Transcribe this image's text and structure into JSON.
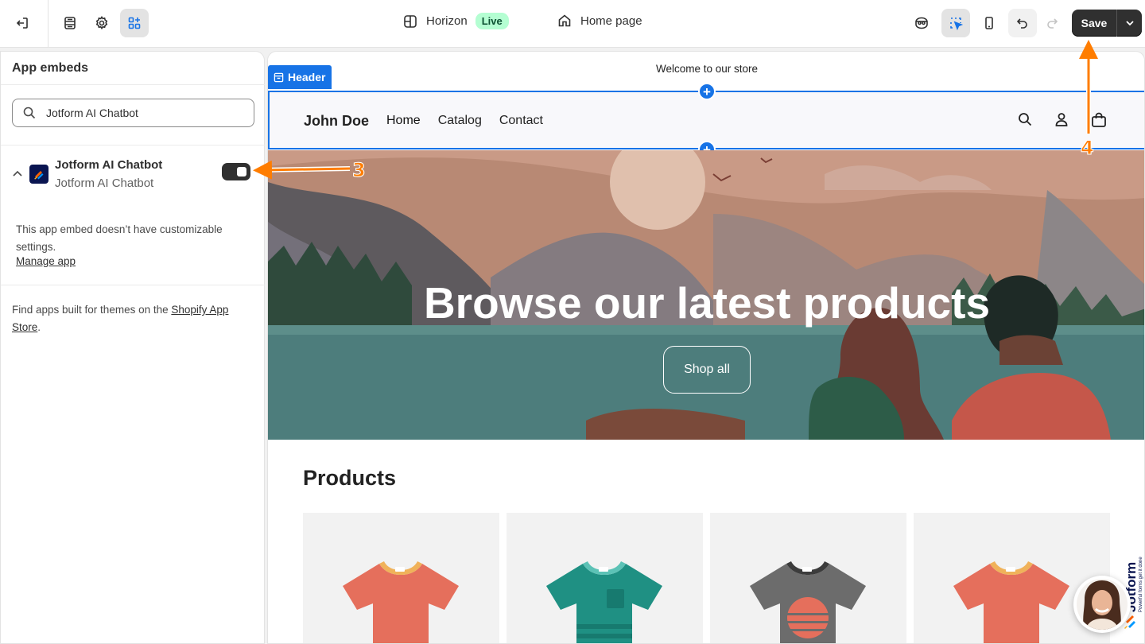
{
  "topbar": {
    "theme_name": "Horizon",
    "theme_status": "Live",
    "page_name": "Home page",
    "save_label": "Save"
  },
  "sidebar": {
    "title": "App embeds",
    "search_value": "Jotform AI Chatbot",
    "app": {
      "name": "Jotform AI Chatbot",
      "subtitle": "Jotform AI Chatbot",
      "enabled": true
    },
    "note": "This app embed doesn’t have customizable settings.",
    "manage_link": "Manage app",
    "find_text": "Find apps built for themes on the ",
    "store_link": "Shopify App Store",
    "find_suffix": "."
  },
  "preview": {
    "announcement": "Welcome to our store",
    "section_tag": "Header",
    "brand": "John Doe",
    "nav": [
      "Home",
      "Catalog",
      "Contact"
    ],
    "hero_title": "Browse our latest products",
    "hero_button": "Shop all",
    "products_title": "Products",
    "product_colors": [
      "#e56f5c",
      "#1f9083",
      "#6c6c6c",
      "#e56f5c"
    ]
  },
  "chat_widget": {
    "brand": "Jotform",
    "tagline": "Powerful forms get it done"
  },
  "annotations": [
    "3",
    "4"
  ],
  "colors": {
    "accent": "#1773e6",
    "annotation": "#ff7d00",
    "live_bg": "#b4fed2"
  }
}
